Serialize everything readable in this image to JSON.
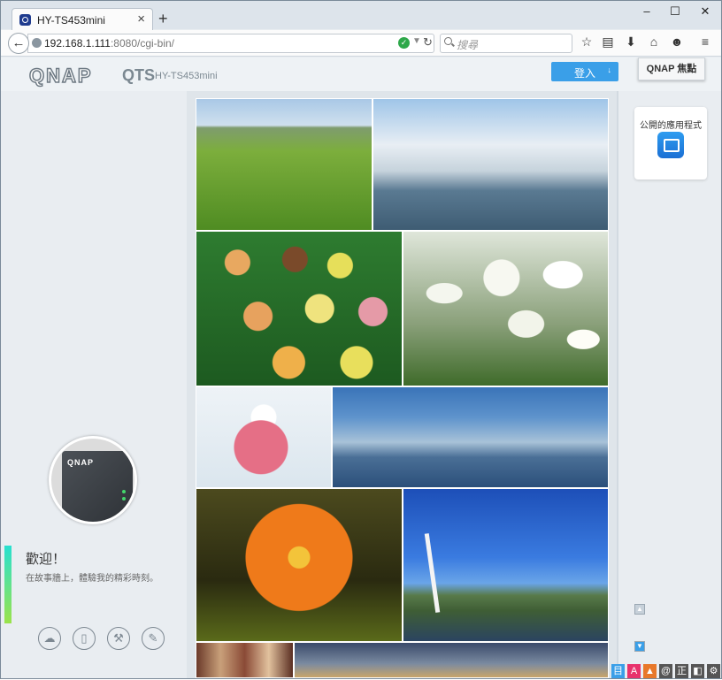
{
  "browser": {
    "tab_title": "HY-TS453mini",
    "tab_close": "×",
    "new_tab": "+",
    "window_controls": [
      "–",
      "☐",
      "✕"
    ],
    "back_glyph": "←",
    "url_host": "192.168.1.111",
    "url_rest": ":8080/cgi-bin/",
    "search_placeholder": "搜尋",
    "toolbar_icons": [
      "star-icon",
      "reading-list-icon",
      "download-icon",
      "home-icon",
      "chat-icon",
      "menu-icon"
    ]
  },
  "header": {
    "logo": "QNAP",
    "product": "QTS",
    "model": "HY-TS453mini",
    "login_label": "登入",
    "focus_label": "QNAP 焦點"
  },
  "welcome": {
    "title": "歡迎！",
    "subtitle": "在故事牆上，體驗我的精彩時刻。",
    "avatar_brand": "QNAP"
  },
  "right_panel": {
    "public_apps_label": "公開的應用程式"
  },
  "footer_icons": [
    "cloud-icon",
    "mobile-icon",
    "tools-icon",
    "edit-icon"
  ],
  "tray_icons": [
    "目",
    "A",
    "",
    "@",
    "正",
    "",
    "⚙"
  ],
  "photos": [
    "balloons-photo",
    "rubber-duck-photo",
    "macarons-photo",
    "tulips-photo",
    "dessert-photo",
    "sky-photo",
    "poppy-photo",
    "bridge-photo",
    "food-photo",
    "sunset-photo"
  ],
  "colors": {
    "accent": "#3a9fe8",
    "page_background": "#e6ebf0",
    "secure_check": "#2ea84a"
  }
}
